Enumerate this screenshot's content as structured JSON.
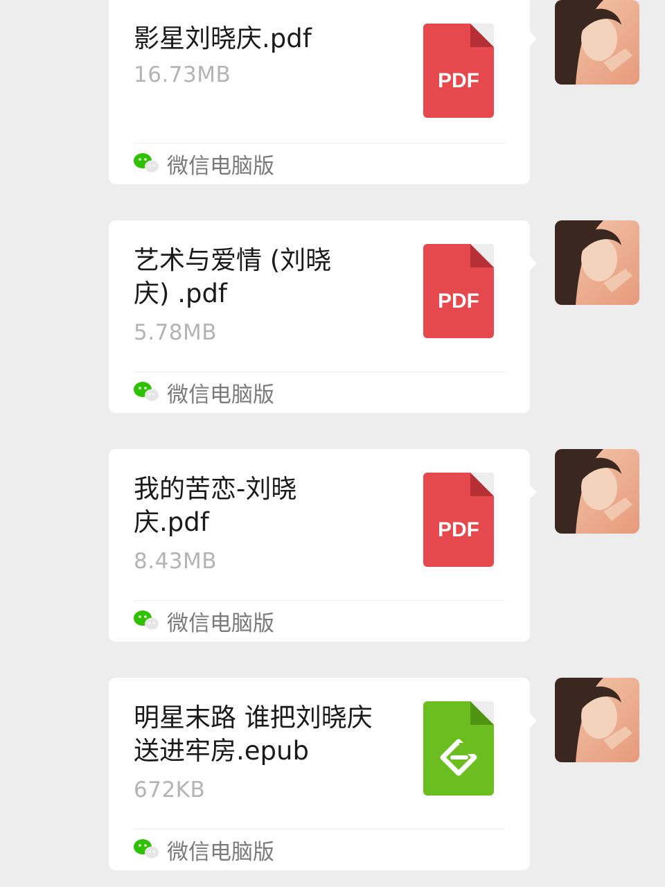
{
  "messages": [
    {
      "file_name": "影星刘晓庆.pdf",
      "file_size": "16.73MB",
      "file_type": "pdf",
      "icon_label": "PDF",
      "source": "微信电脑版"
    },
    {
      "file_name": "艺术与爱情 (刘晓庆) .pdf",
      "file_size": "5.78MB",
      "file_type": "pdf",
      "icon_label": "PDF",
      "source": "微信电脑版"
    },
    {
      "file_name": "我的苦恋-刘晓庆.pdf",
      "file_size": "8.43MB",
      "file_type": "pdf",
      "icon_label": "PDF",
      "source": "微信电脑版"
    },
    {
      "file_name": "明星末路 谁把刘晓庆送进牢房.epub",
      "file_size": "672KB",
      "file_type": "epub",
      "icon_label": "",
      "source": "微信电脑版"
    }
  ],
  "icons": {
    "file_pdf": "pdf-file-icon",
    "file_epub": "epub-file-icon",
    "source": "wechat-icon",
    "avatar": "user-avatar"
  },
  "colors": {
    "background": "#ededed",
    "bubble": "#ffffff",
    "pdf": "#e5484d",
    "epub": "#6cbd1f",
    "wechat_green": "#2dc100"
  }
}
